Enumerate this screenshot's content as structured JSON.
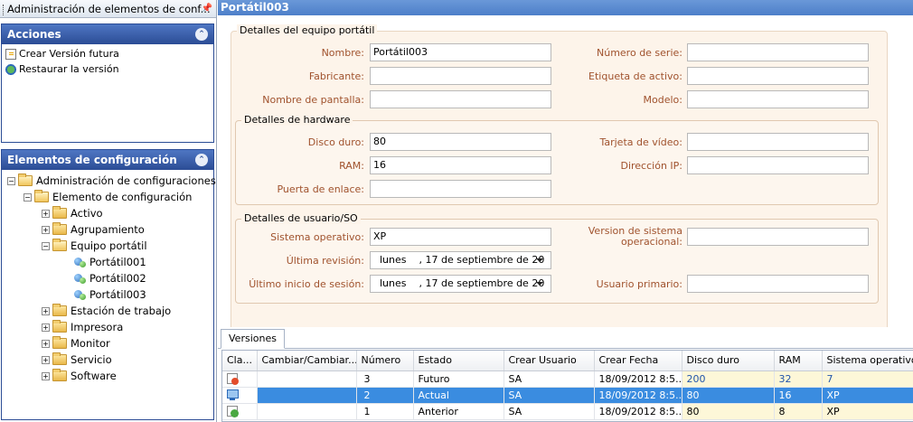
{
  "left_pane": {
    "title": "Administración de elementos de conf...",
    "pin_icon": "pin-icon",
    "actions": {
      "header": "Acciones",
      "items": [
        {
          "label": "Crear Versión futura",
          "icon": "new-version-icon"
        },
        {
          "label": "Restaurar la versión",
          "icon": "restore-version-icon"
        }
      ]
    },
    "ci_tree": {
      "header": "Elementos de configuración",
      "root": "Administración de configuraciones",
      "element": "Elemento de configuración",
      "categories": {
        "activo": "Activo",
        "agrupamiento": "Agrupamiento",
        "equipo": "Equipo portátil",
        "estacion": "Estación de trabajo",
        "impresora": "Impresora",
        "monitor": "Monitor",
        "servicio": "Servicio",
        "software": "Software"
      },
      "laptops": [
        "Portátil001",
        "Portátil002",
        "Portátil003"
      ]
    }
  },
  "document": {
    "title": "Portátil003",
    "details": {
      "title": "Detalles del equipo portátil",
      "nombre_label": "Nombre:",
      "nombre_value": "Portátil003",
      "fabricante_label": "Fabricante:",
      "fabricante_value": "",
      "pantalla_label": "Nombre de pantalla:",
      "pantalla_value": "",
      "serie_label": "Número de serie:",
      "serie_value": "",
      "etiqueta_label": "Etiqueta de activo:",
      "etiqueta_value": "",
      "modelo_label": "Modelo:",
      "modelo_value": ""
    },
    "hardware": {
      "title": "Detalles de hardware",
      "disco_label": "Disco duro:",
      "disco_value": "80",
      "ram_label": "RAM:",
      "ram_value": "16",
      "enlace_label": "Puerta de enlace:",
      "enlace_value": "",
      "video_label": "Tarjeta de vídeo:",
      "video_value": "",
      "ip_label": "Dirección IP:",
      "ip_value": ""
    },
    "user_os": {
      "title": "Detalles de usuario/SO",
      "so_label": "Sistema operativo:",
      "so_value": "XP",
      "revision_label": "Última revisión:",
      "revision_value": "lunes    , 17 de septiembre de 20",
      "inicio_label": "Último inicio de sesión:",
      "inicio_value": "lunes    , 17 de septiembre de 20",
      "version_so_label_1": "Version de sistema",
      "version_so_label_2": "operacional:",
      "version_so_value": "",
      "usuario_label": "Usuario primario:",
      "usuario_value": ""
    }
  },
  "versions": {
    "tab": "Versiones",
    "columns": [
      "Cla...",
      "Cambiar/Cambiar...",
      "Número",
      "Estado",
      "Crear Usuario",
      "Crear Fecha",
      "Disco duro",
      "RAM",
      "Sistema operativo"
    ],
    "rows": [
      {
        "icon": "future-version-icon",
        "cambiar": "",
        "numero": "3",
        "estado": "Futuro",
        "usuario": "SA",
        "fecha": "18/09/2012 8:5...",
        "disco": "200",
        "ram": "32",
        "so": "7"
      },
      {
        "icon": "current-version-icon",
        "cambiar": "",
        "numero": "2",
        "estado": "Actual",
        "usuario": "SA",
        "fecha": "18/09/2012 8:5...",
        "disco": "80",
        "ram": "16",
        "so": "XP"
      },
      {
        "icon": "previous-version-icon",
        "cambiar": "",
        "numero": "1",
        "estado": "Anterior",
        "usuario": "SA",
        "fecha": "18/09/2012 8:5...",
        "disco": "80",
        "ram": "8",
        "so": "XP"
      }
    ]
  }
}
